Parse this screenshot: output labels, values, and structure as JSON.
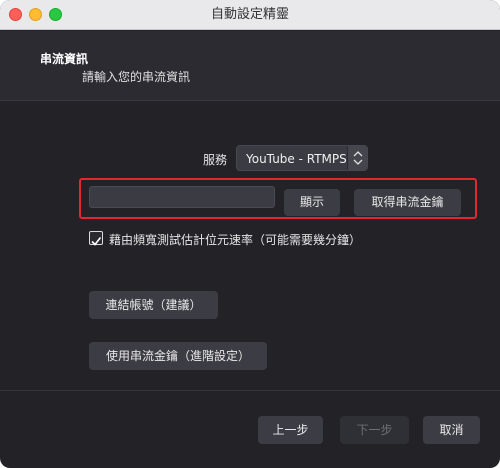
{
  "window": {
    "title": "自動設定精靈"
  },
  "header": {
    "title": "串流資訊",
    "subtitle": "請輸入您的串流資訊"
  },
  "service": {
    "label": "服務",
    "value": "YouTube - RTMPS"
  },
  "stream_key": {
    "value": "",
    "show_label": "顯示",
    "get_key_label": "取得串流金鑰"
  },
  "bandwidth_test": {
    "label": "藉由頻寬測試估計位元速率（可能需要幾分鐘）",
    "checked": true
  },
  "actions": {
    "connect_label": "連結帳號（建議）",
    "use_key_label": "使用串流金鑰（進階設定）"
  },
  "footer": {
    "prev_label": "上一步",
    "next_label": "下一步",
    "cancel_label": "取消"
  },
  "colors": {
    "highlight": "#e3262f",
    "window_bg": "#222227"
  }
}
